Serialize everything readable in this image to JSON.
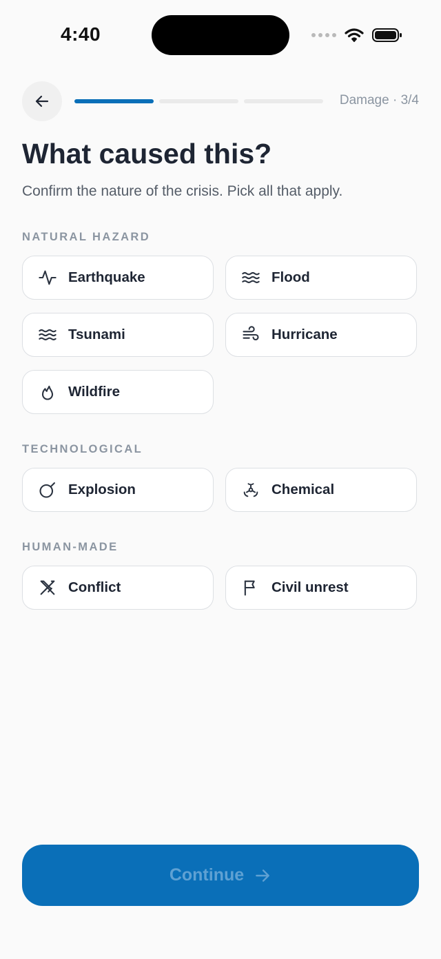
{
  "status_bar": {
    "time": "4:40"
  },
  "header": {
    "step_label": "Damage · 3/4",
    "progress": {
      "current": 1,
      "total": 3
    }
  },
  "title": "What caused this?",
  "subtitle": "Confirm the nature of the crisis. Pick all that apply.",
  "sections": [
    {
      "label": "NATURAL HAZARD",
      "options": [
        {
          "label": "Earthquake",
          "icon": "pulse-icon"
        },
        {
          "label": "Flood",
          "icon": "waves-icon"
        },
        {
          "label": "Tsunami",
          "icon": "waves-icon"
        },
        {
          "label": "Hurricane",
          "icon": "wind-icon"
        },
        {
          "label": "Wildfire",
          "icon": "flame-icon"
        }
      ]
    },
    {
      "label": "TECHNOLOGICAL",
      "options": [
        {
          "label": "Explosion",
          "icon": "bomb-icon"
        },
        {
          "label": "Chemical",
          "icon": "biohazard-icon"
        }
      ]
    },
    {
      "label": "HUMAN-MADE",
      "options": [
        {
          "label": "Conflict",
          "icon": "crossed-swords-icon"
        },
        {
          "label": "Civil unrest",
          "icon": "flag-icon"
        }
      ]
    }
  ],
  "continue_button": {
    "label": "Continue",
    "icon": "arrow-right-icon"
  },
  "colors": {
    "accent": "#0a6fb8",
    "background": "#fafafa",
    "chip_border": "#dcdfe3"
  }
}
